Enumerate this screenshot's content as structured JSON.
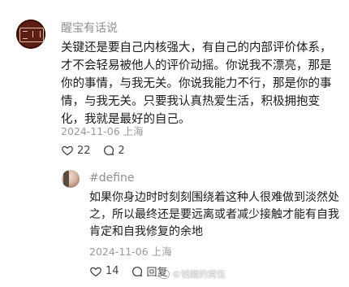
{
  "main_comment": {
    "username": "醒宝有话说",
    "text": "关键还是要自己内核强大，有自己的内部评价体系，才不会轻易被他人的评价动摇。你说我不漂亮，那是你的事情，与我无关。你说我能力不行，那是你的事情，与我无关。只要我认真热爱生活，积极拥抱变化，我就是最好的自己。",
    "date": "2024-11-06",
    "location": "上海",
    "likes": "22",
    "replies": "2"
  },
  "reply": {
    "username": "#define",
    "text": "如果你身边时时刻刻围绕着这种人很难做到淡然处之，所以最终还是要远离或者减少接触才能有自我肯定和自我修复的余地",
    "date": "2024-11-06",
    "location": "上海",
    "likes": "14",
    "reply_label": "回复"
  },
  "watermark": "©钱醒的窝住",
  "icons": {
    "like": "heart-icon",
    "comment": "comment-bubble-icon"
  }
}
